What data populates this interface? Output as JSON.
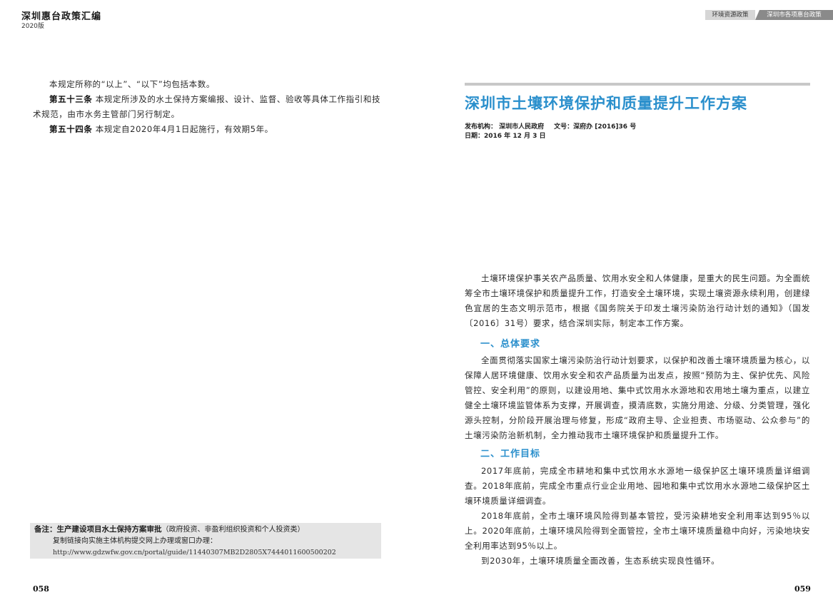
{
  "left_page": {
    "book_title": "深圳惠台政策汇编",
    "book_year": "2020版",
    "line1": "本规定所称的“以上”、“以下”均包括本数。",
    "art53_label": "第五十三条",
    "art53_text": " 本规定所涉及的水土保持方案编报、设计、监督、验收等具体工作指引和技术规范，由市水务主管部门另行制定。",
    "art54_label": "第五十四条",
    "art54_text": " 本规定自2020年4月1日起施行，有效期5年。",
    "note": {
      "label": "备注：生产建设项目水土保持方案审批",
      "paren": "（政府投资、非盈利组织投资和个人投资类）",
      "line2": "复制链接向实施主体机构提交网上办理或窗口办理：",
      "url": "http://www.gdzwfw.gov.cn/portal/guide/11440307MB2D2805X7444011600500202"
    },
    "page_number": "058"
  },
  "right_page": {
    "tab_category": "环境资源政策",
    "tab_section": "深圳市各项惠台政策",
    "title": "深圳市土壤环境保护和质量提升工作方案",
    "meta_issuer": "发布机构：  深圳市人民政府",
    "meta_docno": "文号：深府办 [2016]36 号",
    "meta_date": "日期：2016 年 12 月 3 日",
    "intro": "土壤环境保护事关农产品质量、饮用水安全和人体健康，是重大的民生问题。为全面统筹全市土壤环境保护和质量提升工作，打造安全土壤环境，实现土壤资源永续利用，创建绿色宜居的生态文明示范市，根据《国务院关于印发土壤污染防治行动计划的通知》（国发〔2016〕31号）要求，结合深圳实际，制定本工作方案。",
    "h1": "一、总体要求",
    "p1": "全面贯彻落实国家土壤污染防治行动计划要求，以保护和改善土壤环境质量为核心，以保障人居环境健康、饮用水安全和农产品质量为出发点，按照“预防为主、保护优先、风险管控、安全利用”的原则，以建设用地、集中式饮用水水源地和农用地土壤为重点，以建立健全土壤环境监管体系为支撑，开展调查，摸清底数，实施分用途、分级、分类管理，强化源头控制，分阶段开展治理与修复，形成“政府主导、企业担责、市场驱动、公众参与”的土壤污染防治新机制，全力推动我市土壤环境保护和质量提升工作。",
    "h2": "二、工作目标",
    "p2": "2017年底前，完成全市耕地和集中式饮用水水源地一级保护区土壤环境质量详细调查。2018年底前，完成全市重点行业企业用地、园地和集中式饮用水水源地二级保护区土壤环境质量详细调查。",
    "p3": "2018年底前，全市土壤环境风险得到基本管控，受污染耕地安全利用率达到95％以上。2020年底前，土壤环境风险得到全面管控，全市土壤环境质量稳中向好，污染地块安全利用率达到95％以上。",
    "p4": "到2030年，土壤环境质量全面改善，生态系统实现良性循环。",
    "page_number": "059"
  }
}
